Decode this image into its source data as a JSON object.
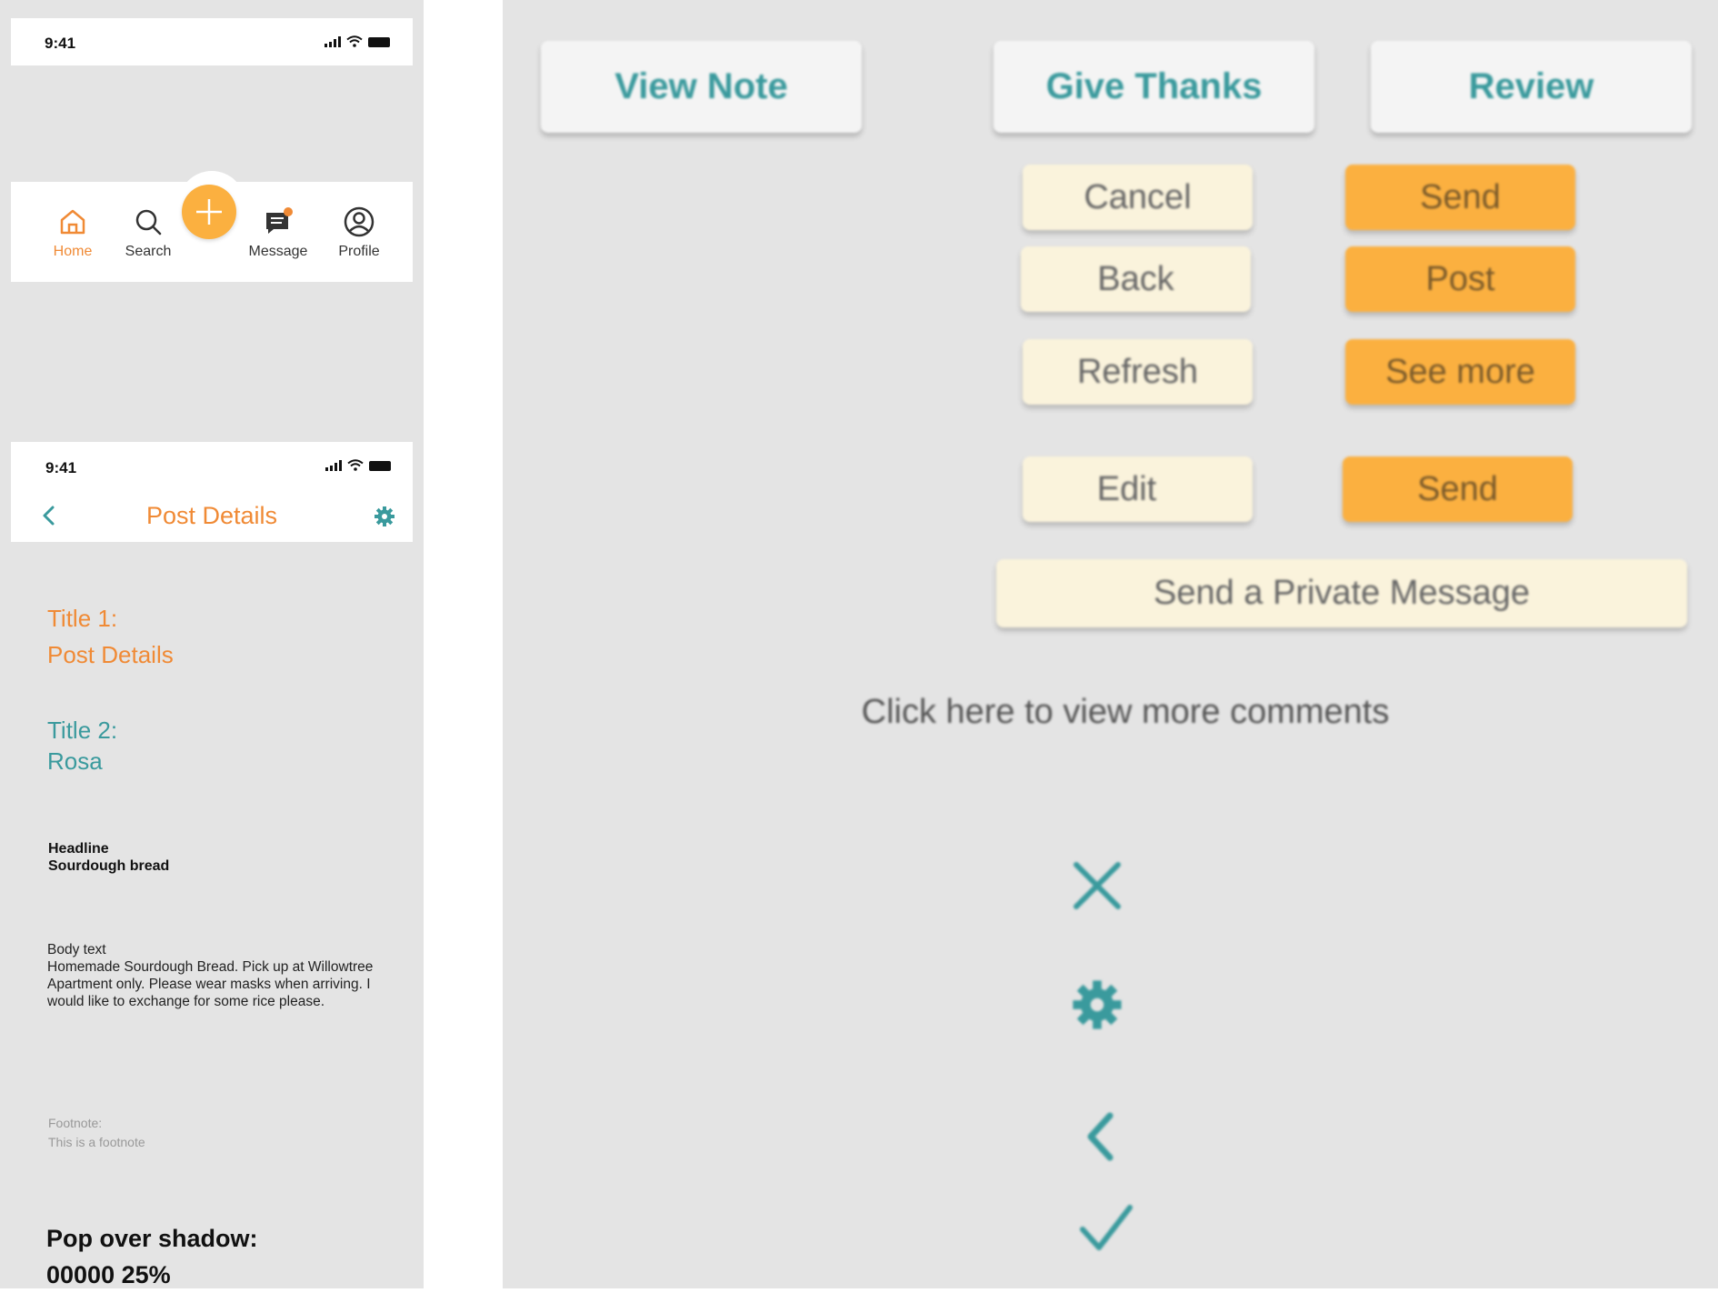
{
  "status_bar_1": {
    "time": "9:41"
  },
  "tab_bar": {
    "items": [
      {
        "label": "Home",
        "icon": "home-icon",
        "active": true
      },
      {
        "label": "Search",
        "icon": "search-icon",
        "active": false
      },
      {
        "label": "Message",
        "icon": "message-icon",
        "active": false
      },
      {
        "label": "Profile",
        "icon": "profile-icon",
        "active": false
      }
    ],
    "fab_icon": "plus-icon"
  },
  "status_bar_2": {
    "time": "9:41"
  },
  "post_header": {
    "title": "Post Details",
    "back_icon": "chevron-left-icon",
    "settings_icon": "gear-icon"
  },
  "typography": {
    "title1_label": "Title 1:",
    "title1_value": "Post Details",
    "title2_label": "Title 2:",
    "title2_value": "Rosa",
    "headline_label": "Headline",
    "headline_value": "Sourdough bread",
    "body_label": "Body text",
    "body_value": "Homemade Sourdough Bread. Pick up at Willowtree Apartment only. Please wear masks when arriving. I would like to exchange for some rice please.",
    "footnote_label": "Footnote:",
    "footnote_value": "This is a footnote",
    "pop_label": "Pop over shadow:",
    "pop_value": "00000 25%"
  },
  "buttons": {
    "view_note": "View Note",
    "give_thanks": "Give Thanks",
    "review": "Review",
    "cancel": "Cancel",
    "send_1": "Send",
    "back": "Back",
    "post": "Post",
    "refresh": "Refresh",
    "see_more": "See more",
    "edit": "Edit",
    "send_2": "Send",
    "private_message": "Send a Private Message"
  },
  "more_comments_link": "Click here to view more comments",
  "icons": [
    "close-icon",
    "gear-icon",
    "chevron-left-icon",
    "check-icon"
  ],
  "colors": {
    "accent_orange": "#f08a35",
    "fab_orange": "#fbb040",
    "teal": "#3a9a9d",
    "cream": "#faf3dc",
    "panel_gray": "#e4e4e4"
  }
}
